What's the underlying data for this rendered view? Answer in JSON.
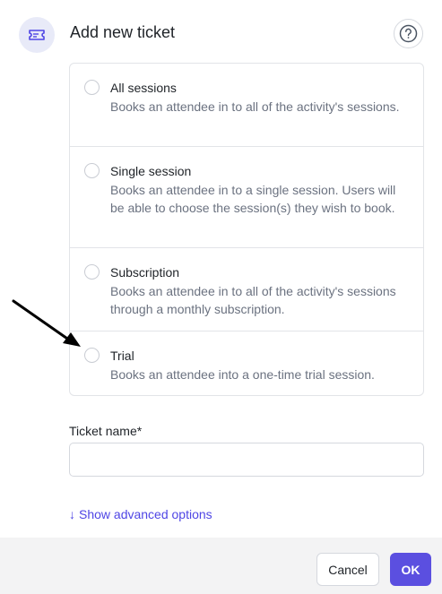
{
  "header": {
    "icon": "ticket-icon",
    "title": "Add new ticket",
    "help_icon": "help-icon"
  },
  "options": [
    {
      "label": "All sessions",
      "description": "Books an attendee in to all of the activity's sessions.",
      "selected": false
    },
    {
      "label": "Single session",
      "description": "Books an attendee in to a single session. Users will be able to choose the session(s) they wish to book.",
      "selected": false
    },
    {
      "label": "Subscription",
      "description": "Books an attendee in to all of the activity's sessions through a monthly subscription.",
      "selected": false
    },
    {
      "label": "Trial",
      "description": "Books an attendee into a one-time trial session.",
      "selected": false
    }
  ],
  "ticket_name": {
    "label": "Ticket name*",
    "value": ""
  },
  "advanced": {
    "arrow": "↓",
    "label": "Show advanced options"
  },
  "footer": {
    "cancel_label": "Cancel",
    "ok_label": "OK"
  },
  "colors": {
    "accent": "#5b4fe0",
    "link": "#4f46e5",
    "badge_bg": "#e8eaf8",
    "footer_bg": "#f3f3f4"
  }
}
